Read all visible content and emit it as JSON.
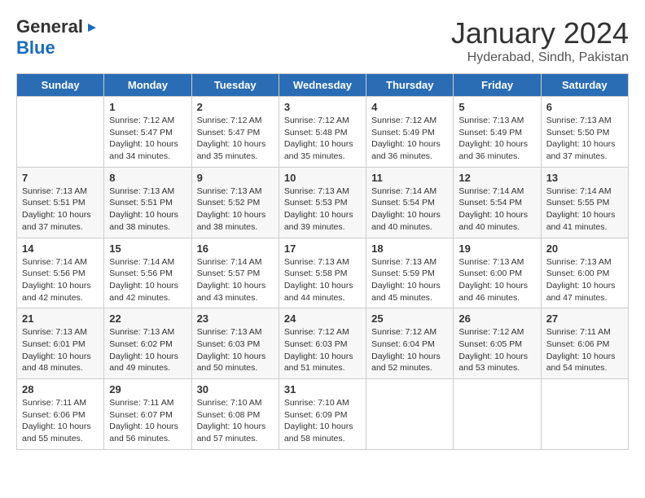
{
  "header": {
    "logo_general": "General",
    "logo_blue": "Blue",
    "month": "January 2024",
    "location": "Hyderabad, Sindh, Pakistan"
  },
  "days_of_week": [
    "Sunday",
    "Monday",
    "Tuesday",
    "Wednesday",
    "Thursday",
    "Friday",
    "Saturday"
  ],
  "weeks": [
    [
      {
        "day": "",
        "info": ""
      },
      {
        "day": "1",
        "info": "Sunrise: 7:12 AM\nSunset: 5:47 PM\nDaylight: 10 hours\nand 34 minutes."
      },
      {
        "day": "2",
        "info": "Sunrise: 7:12 AM\nSunset: 5:47 PM\nDaylight: 10 hours\nand 35 minutes."
      },
      {
        "day": "3",
        "info": "Sunrise: 7:12 AM\nSunset: 5:48 PM\nDaylight: 10 hours\nand 35 minutes."
      },
      {
        "day": "4",
        "info": "Sunrise: 7:12 AM\nSunset: 5:49 PM\nDaylight: 10 hours\nand 36 minutes."
      },
      {
        "day": "5",
        "info": "Sunrise: 7:13 AM\nSunset: 5:49 PM\nDaylight: 10 hours\nand 36 minutes."
      },
      {
        "day": "6",
        "info": "Sunrise: 7:13 AM\nSunset: 5:50 PM\nDaylight: 10 hours\nand 37 minutes."
      }
    ],
    [
      {
        "day": "7",
        "info": "Sunrise: 7:13 AM\nSunset: 5:51 PM\nDaylight: 10 hours\nand 37 minutes."
      },
      {
        "day": "8",
        "info": "Sunrise: 7:13 AM\nSunset: 5:51 PM\nDaylight: 10 hours\nand 38 minutes."
      },
      {
        "day": "9",
        "info": "Sunrise: 7:13 AM\nSunset: 5:52 PM\nDaylight: 10 hours\nand 38 minutes."
      },
      {
        "day": "10",
        "info": "Sunrise: 7:13 AM\nSunset: 5:53 PM\nDaylight: 10 hours\nand 39 minutes."
      },
      {
        "day": "11",
        "info": "Sunrise: 7:14 AM\nSunset: 5:54 PM\nDaylight: 10 hours\nand 40 minutes."
      },
      {
        "day": "12",
        "info": "Sunrise: 7:14 AM\nSunset: 5:54 PM\nDaylight: 10 hours\nand 40 minutes."
      },
      {
        "day": "13",
        "info": "Sunrise: 7:14 AM\nSunset: 5:55 PM\nDaylight: 10 hours\nand 41 minutes."
      }
    ],
    [
      {
        "day": "14",
        "info": "Sunrise: 7:14 AM\nSunset: 5:56 PM\nDaylight: 10 hours\nand 42 minutes."
      },
      {
        "day": "15",
        "info": "Sunrise: 7:14 AM\nSunset: 5:56 PM\nDaylight: 10 hours\nand 42 minutes."
      },
      {
        "day": "16",
        "info": "Sunrise: 7:14 AM\nSunset: 5:57 PM\nDaylight: 10 hours\nand 43 minutes."
      },
      {
        "day": "17",
        "info": "Sunrise: 7:13 AM\nSunset: 5:58 PM\nDaylight: 10 hours\nand 44 minutes."
      },
      {
        "day": "18",
        "info": "Sunrise: 7:13 AM\nSunset: 5:59 PM\nDaylight: 10 hours\nand 45 minutes."
      },
      {
        "day": "19",
        "info": "Sunrise: 7:13 AM\nSunset: 6:00 PM\nDaylight: 10 hours\nand 46 minutes."
      },
      {
        "day": "20",
        "info": "Sunrise: 7:13 AM\nSunset: 6:00 PM\nDaylight: 10 hours\nand 47 minutes."
      }
    ],
    [
      {
        "day": "21",
        "info": "Sunrise: 7:13 AM\nSunset: 6:01 PM\nDaylight: 10 hours\nand 48 minutes."
      },
      {
        "day": "22",
        "info": "Sunrise: 7:13 AM\nSunset: 6:02 PM\nDaylight: 10 hours\nand 49 minutes."
      },
      {
        "day": "23",
        "info": "Sunrise: 7:13 AM\nSunset: 6:03 PM\nDaylight: 10 hours\nand 50 minutes."
      },
      {
        "day": "24",
        "info": "Sunrise: 7:12 AM\nSunset: 6:03 PM\nDaylight: 10 hours\nand 51 minutes."
      },
      {
        "day": "25",
        "info": "Sunrise: 7:12 AM\nSunset: 6:04 PM\nDaylight: 10 hours\nand 52 minutes."
      },
      {
        "day": "26",
        "info": "Sunrise: 7:12 AM\nSunset: 6:05 PM\nDaylight: 10 hours\nand 53 minutes."
      },
      {
        "day": "27",
        "info": "Sunrise: 7:11 AM\nSunset: 6:06 PM\nDaylight: 10 hours\nand 54 minutes."
      }
    ],
    [
      {
        "day": "28",
        "info": "Sunrise: 7:11 AM\nSunset: 6:06 PM\nDaylight: 10 hours\nand 55 minutes."
      },
      {
        "day": "29",
        "info": "Sunrise: 7:11 AM\nSunset: 6:07 PM\nDaylight: 10 hours\nand 56 minutes."
      },
      {
        "day": "30",
        "info": "Sunrise: 7:10 AM\nSunset: 6:08 PM\nDaylight: 10 hours\nand 57 minutes."
      },
      {
        "day": "31",
        "info": "Sunrise: 7:10 AM\nSunset: 6:09 PM\nDaylight: 10 hours\nand 58 minutes."
      },
      {
        "day": "",
        "info": ""
      },
      {
        "day": "",
        "info": ""
      },
      {
        "day": "",
        "info": ""
      }
    ]
  ]
}
